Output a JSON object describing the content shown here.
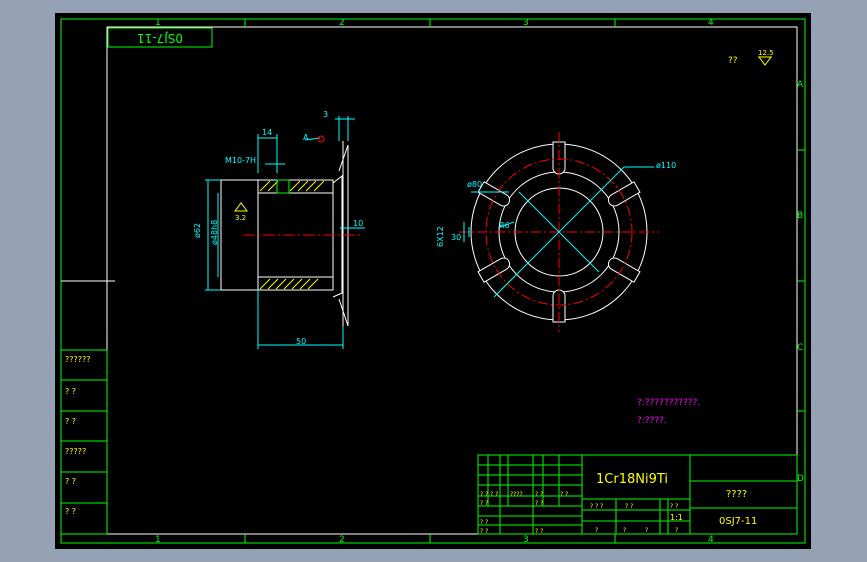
{
  "drawing": {
    "title_box_upside_down": "0SJ7-11",
    "surface_roughness_note": "??",
    "surface_roughness_value": "12.5",
    "zone_columns": [
      "1",
      "2",
      "3",
      "4"
    ],
    "zone_rows": [
      "A",
      "B",
      "C",
      "D"
    ]
  },
  "section_view": {
    "dim_14": "14",
    "dim_3": "3",
    "thread": "M10-7H",
    "datum_a": "A",
    "roughness": "3.2",
    "dia_62": "ø62",
    "dia_48": "ø48h8",
    "dim_10": "10",
    "dim_50": "50"
  },
  "front_view": {
    "dia_110": "ø110",
    "dia_80": "ø80",
    "radius": "R6",
    "slot": "6X12",
    "slot_detail": "30"
  },
  "side_table": {
    "rows": [
      "??????",
      "?  ?",
      "?  ?",
      "?????",
      "?  ?",
      "?  ?"
    ]
  },
  "notes": {
    "line1": "?:???????????.",
    "line2": "?:????."
  },
  "title_block": {
    "material": "1Cr18Ni9Ti",
    "name": "????",
    "code": "0SJ7-11",
    "scale": "1:1",
    "row_labels": [
      "? ?",
      "? ?",
      "????",
      "? ?",
      "? ?"
    ],
    "bottom_labels": [
      "? ?",
      "? ?",
      "? ?"
    ],
    "middle_labels": [
      "? ? ?",
      "? ?",
      "? ?"
    ],
    "middle_labels_2": [
      "?",
      "?",
      "?",
      "?"
    ]
  }
}
